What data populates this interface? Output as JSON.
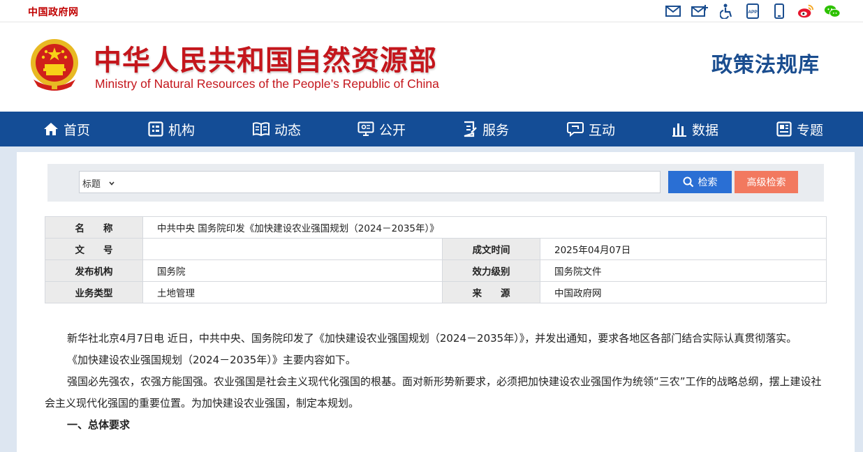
{
  "topbar": {
    "gov_link": "中国政府网",
    "icons": [
      "mail-icon",
      "mail-plus-icon",
      "accessibility-icon",
      "app-icon",
      "mobile-icon",
      "weibo-icon",
      "wechat-icon"
    ],
    "app_text": "APP"
  },
  "header": {
    "title_cn": "中华人民共和国自然资源部",
    "title_en": "Ministry of Natural Resources of the People’s Republic of China",
    "library_title": "政策法规库"
  },
  "nav": {
    "items": [
      {
        "label": "首页",
        "icon": "home-icon"
      },
      {
        "label": "机构",
        "icon": "org-icon"
      },
      {
        "label": "动态",
        "icon": "news-icon"
      },
      {
        "label": "公开",
        "icon": "disclosure-icon"
      },
      {
        "label": "服务",
        "icon": "service-icon"
      },
      {
        "label": "互动",
        "icon": "chat-icon"
      },
      {
        "label": "数据",
        "icon": "chart-icon"
      },
      {
        "label": "专题",
        "icon": "topic-icon"
      }
    ]
  },
  "search": {
    "field_selected": "标题",
    "value": "",
    "search_label": "检索",
    "advanced_label": "高级检索"
  },
  "meta": {
    "name_label": "名　　称",
    "name_value": "中共中央  国务院印发《加快建设农业强国规划（2024－2035年）》",
    "docno_label": "文　　号",
    "docno_value": "",
    "date_label": "成文时间",
    "date_value": "2025年04月07日",
    "issuer_label": "发布机构",
    "issuer_value": "国务院",
    "level_label": "效力级别",
    "level_value": "国务院文件",
    "type_label": "业务类型",
    "type_value": "土地管理",
    "source_label": "来　　源",
    "source_value": "中国政府网"
  },
  "article": {
    "p1": "新华社北京4月7日电  近日，中共中央、国务院印发了《加快建设农业强国规划（2024－2035年）》，并发出通知，要求各地区各部门结合实际认真贯彻落实。",
    "p2": "《加快建设农业强国规划（2024－2035年）》主要内容如下。",
    "p3": "强国必先强农，农强方能国强。农业强国是社会主义现代化强国的根基。面对新形势新要求，必须把加快建设农业强国作为统领“三农”工作的战略总纲，摆上建设社会主义现代化强国的重要位置。为加快建设农业强国，制定本规划。",
    "h1": "一、总体要求"
  },
  "colors": {
    "brand_red": "#c4161c",
    "nav_blue": "#144d96",
    "search_blue": "#2a6fd4",
    "advanced_orange": "#f2795f"
  }
}
